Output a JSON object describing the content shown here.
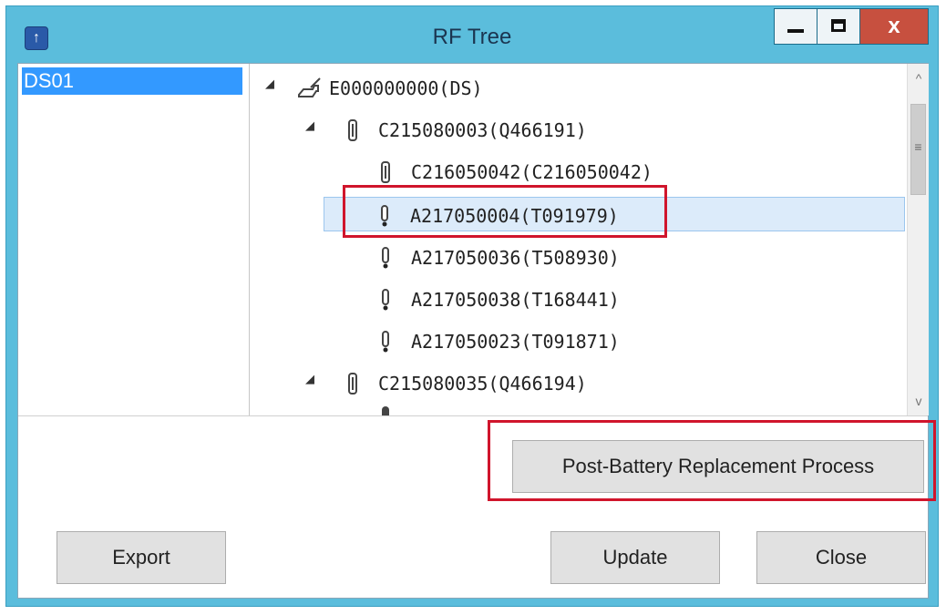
{
  "window": {
    "title": "RF Tree",
    "close_glyph": "x",
    "minimize_glyph": "_"
  },
  "left_list": {
    "items": [
      {
        "label": "DS01",
        "selected": true
      }
    ]
  },
  "tree": {
    "rows": [
      {
        "label": "E000000000(DS)",
        "icon": "ds-handset-icon",
        "expander": "expanded"
      },
      {
        "label": "C215080003(Q466191)",
        "icon": "repeater-icon",
        "expander": "expanded"
      },
      {
        "label": "C216050042(C216050042)",
        "icon": "repeater-icon",
        "expander": "none"
      },
      {
        "label": "A217050004(T091979)",
        "icon": "transmitter-icon",
        "expander": "none",
        "selected": true
      },
      {
        "label": "A217050036(T508930)",
        "icon": "transmitter-icon",
        "expander": "none"
      },
      {
        "label": "A217050038(T168441)",
        "icon": "transmitter-icon",
        "expander": "none"
      },
      {
        "label": "A217050023(T091871)",
        "icon": "transmitter-icon",
        "expander": "none"
      },
      {
        "label": "C215080035(Q466194)",
        "icon": "repeater-icon",
        "expander": "expanded"
      }
    ]
  },
  "buttons": {
    "post_battery": "Post-Battery Replacement Process",
    "export": "Export",
    "update": "Update",
    "close": "Close"
  },
  "colors": {
    "highlight": "#d0152c",
    "titlebar": "#5bbddc",
    "selection": "#3399ff"
  }
}
